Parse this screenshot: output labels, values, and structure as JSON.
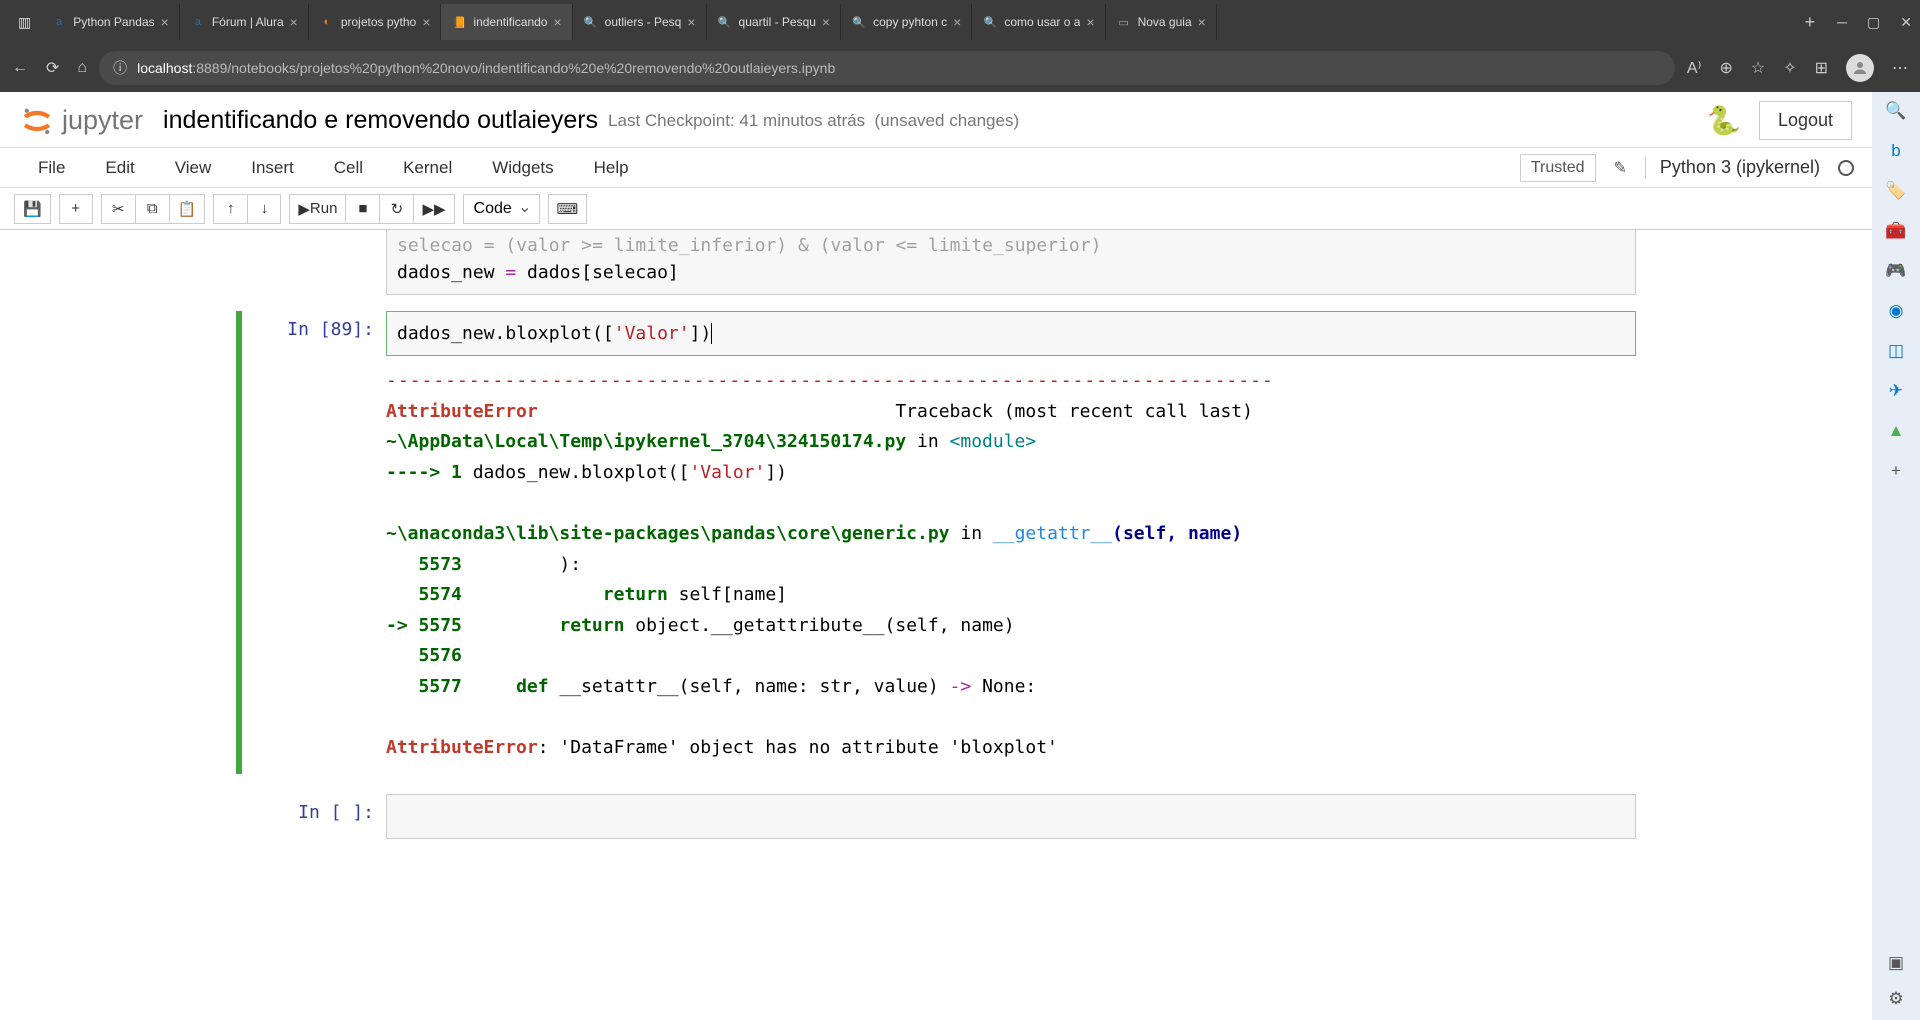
{
  "browser": {
    "tabs": [
      {
        "title": "Python Pandas",
        "favicon": "a",
        "faviconColor": "#1f6fb2"
      },
      {
        "title": "Fórum | Alura",
        "favicon": "a",
        "faviconColor": "#1f6fb2"
      },
      {
        "title": "projetos pytho",
        "favicon": "◐",
        "faviconColor": "#e67e22"
      },
      {
        "title": "indentificando",
        "favicon": "📙",
        "faviconColor": "#e67e22",
        "active": true
      },
      {
        "title": "outliers - Pesq",
        "favicon": "🔍",
        "faviconColor": "#3498db"
      },
      {
        "title": "quartil - Pesqu",
        "favicon": "🔍",
        "faviconColor": "#3498db"
      },
      {
        "title": "copy pyhton c",
        "favicon": "🔍",
        "faviconColor": "#3498db"
      },
      {
        "title": "como usar o a",
        "favicon": "🔍",
        "faviconColor": "#3498db"
      },
      {
        "title": "Nova guia",
        "favicon": "▭",
        "faviconColor": "#aaa"
      }
    ],
    "url_host": "localhost",
    "url_path": ":8889/notebooks/projetos%20python%20novo/indentificando%20e%20removendo%20outlaieyers.ipynb"
  },
  "jupyter": {
    "logo_text": "jupyter",
    "notebook_name": "indentificando e removendo outlaieyers",
    "checkpoint": "Last Checkpoint: 41 minutos atrás",
    "unsaved": "(unsaved changes)",
    "logout": "Logout",
    "menus": [
      "File",
      "Edit",
      "View",
      "Insert",
      "Cell",
      "Kernel",
      "Widgets",
      "Help"
    ],
    "trusted": "Trusted",
    "kernel": "Python 3 (ipykernel)",
    "run_label": "Run",
    "cell_type": "Code"
  },
  "cells": {
    "partial_top_line1": "selecao = (valor >= limite_inferior) & (valor <= limite_superior)",
    "partial_top_line2_pre": "dados_new ",
    "partial_top_line2_op": "=",
    "partial_top_line2_post": " dados[selecao]",
    "in89_prompt": "In [89]:",
    "in89_code_pre": "dados_new.bloxplot([",
    "in89_code_str": "'Valor'",
    "in89_code_post": "])",
    "empty_prompt": "In [ ]:"
  },
  "error": {
    "dashes": "---------------------------------------------------------------------------",
    "name": "AttributeError",
    "traceback_label": "Traceback (most recent call last)",
    "frame1_path": "~\\AppData\\Local\\Temp\\ipykernel_3704\\324150174.py",
    "frame1_in": " in ",
    "frame1_mod": "<module>",
    "frame1_arrow": "----> 1 ",
    "frame1_code1": "dados_new",
    "frame1_code2": ".bloxplot([",
    "frame1_code3": "'Valor'",
    "frame1_code4": "])",
    "frame2_path": "~\\anaconda3\\lib\\site-packages\\pandas\\core\\generic.py",
    "frame2_in": " in ",
    "frame2_func": "__getattr__",
    "frame2_sig": "(self, name)",
    "lines": {
      "l5573n": "   5573",
      "l5573": "         ):",
      "l5574n": "   5574",
      "l5574a": "             ",
      "l5574k": "return",
      "l5574b": " self[name]",
      "l5575arrow": "-> ",
      "l5575n": "5575",
      "l5575a": "         ",
      "l5575k": "return",
      "l5575b": " object.__getattribute__(self, name)",
      "l5576n": "   5576",
      "l5576": "",
      "l5577n": "   5577",
      "l5577a": "     ",
      "l5577k": "def",
      "l5577b": " __setattr__(self, name: str, value) ",
      "l5577c": "->",
      "l5577d": " None:"
    },
    "final_name": "AttributeError",
    "final_msg": ": 'DataFrame' object has no attribute 'bloxplot'"
  }
}
